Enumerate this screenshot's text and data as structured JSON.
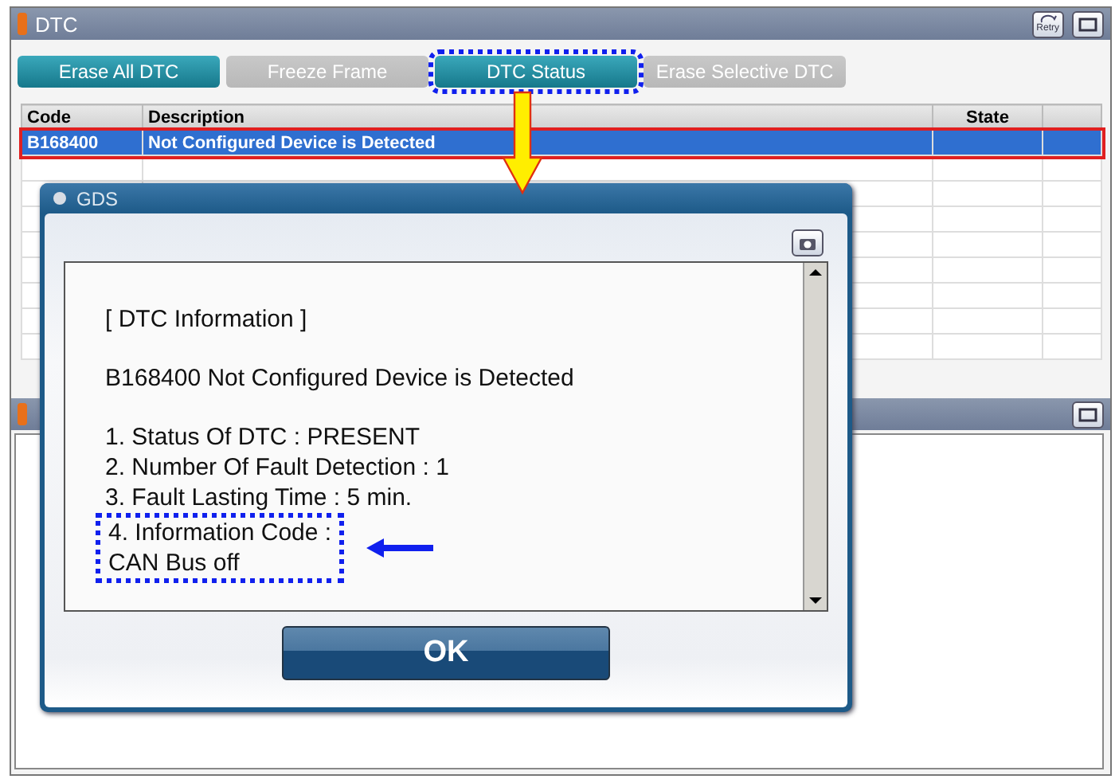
{
  "window": {
    "title": "DTC",
    "retry_label": "Retry"
  },
  "buttons": [
    {
      "label": "Erase All DTC",
      "disabled": false,
      "highlighted": false
    },
    {
      "label": "Freeze Frame",
      "disabled": true,
      "highlighted": false
    },
    {
      "label": "DTC Status",
      "disabled": false,
      "highlighted": true
    },
    {
      "label": "Erase Selective DTC",
      "disabled": true,
      "highlighted": false
    }
  ],
  "table": {
    "columns": [
      "Code",
      "Description",
      "State"
    ],
    "rows": [
      {
        "cells": [
          "B168400",
          "Not Configured Device is Detected"
        ],
        "selected": true,
        "highlighted": true
      }
    ]
  },
  "dialog": {
    "title": "GDS",
    "heading": "[ DTC Information ]",
    "dtc_line": "B168400 Not Configured Device is Detected",
    "items": [
      "1. Status Of DTC : PRESENT",
      "2. Number Of Fault Detection : 1",
      "3. Fault Lasting Time : 5 min."
    ],
    "info_code": {
      "lines": [
        "4. Information Code :",
        "CAN Bus off"
      ],
      "highlighted": true
    },
    "ok_label": "OK"
  }
}
